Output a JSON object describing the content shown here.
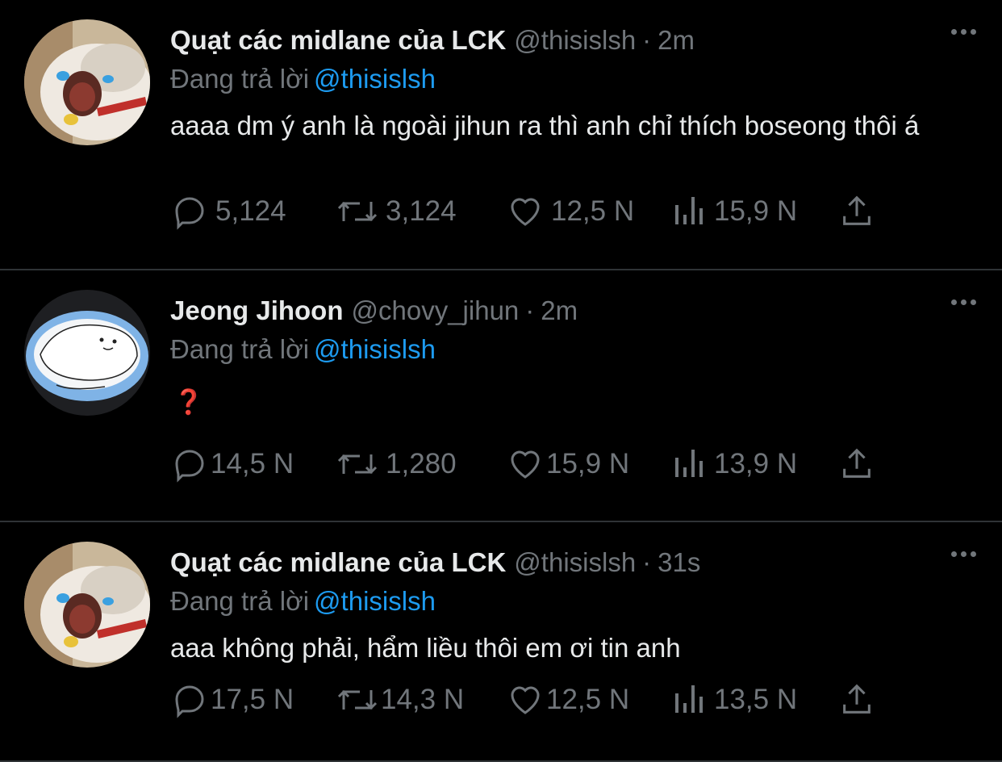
{
  "tweets": [
    {
      "display_name": "Quạt các midlane của LCK",
      "handle": "@thisislsh",
      "separator": "·",
      "time": "2m",
      "reply_prefix": "Đang trả lời",
      "reply_to": "@thisislsh",
      "text": "aaaa dm ý anh là ngoài jihun ra thì anh chỉ thích boseong thôi á",
      "replies": "5,124",
      "retweets": "3,124",
      "likes": "12,5 N",
      "views": "15,9 N"
    },
    {
      "display_name": "Jeong Jihoon",
      "handle": "@chovy_jihun",
      "separator": "·",
      "time": "2m",
      "reply_prefix": "Đang trả lời",
      "reply_to": "@thisislsh",
      "text": "❓",
      "replies": "14,5 N",
      "retweets": "1,280",
      "likes": "15,9 N",
      "views": "13,9 N"
    },
    {
      "display_name": "Quạt các midlane của LCK",
      "handle": "@thisislsh",
      "separator": "·",
      "time": "31s",
      "reply_prefix": "Đang trả lời",
      "reply_to": "@thisislsh",
      "text": "aaa không phải, hẩm liều thôi em ơi tin anh",
      "replies": "17,5 N",
      "retweets": "14,3 N",
      "likes": "12,5 N",
      "views": "13,5 N"
    }
  ],
  "icons": {
    "reply": "reply-icon",
    "retweet": "retweet-icon",
    "like": "heart-icon",
    "views": "views-icon",
    "share": "share-icon",
    "more": "more-icon"
  },
  "colors": {
    "background": "#000000",
    "text": "#e7e9ea",
    "muted": "#71767b",
    "link": "#1d9bf0",
    "divider": "#2f3336"
  }
}
